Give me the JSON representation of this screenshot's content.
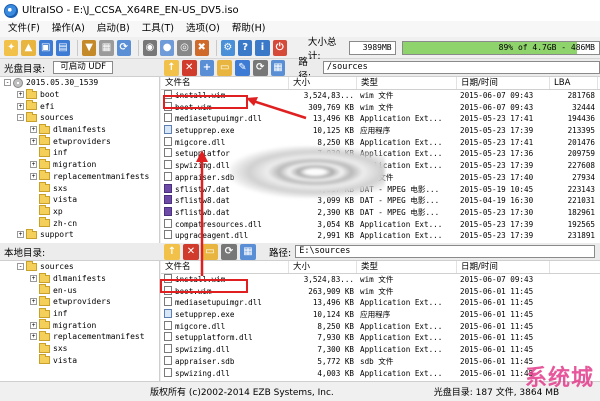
{
  "window": {
    "title": "UltraISO - E:\\J_CCSA_X64RE_EN-US_DV5.iso"
  },
  "menu": [
    "文件(F)",
    "操作(A)",
    "启动(B)",
    "工具(T)",
    "选项(O)",
    "帮助(H)"
  ],
  "toolbar": {
    "size_label": "大小总计:",
    "size_value": "3989MB",
    "capacity_text": "89% of 4.7GB - 486MB",
    "capacity_fraction": 0.89
  },
  "top": {
    "tree_label": "光盘目录:",
    "boot_label": "可启动 UDF",
    "path_label": "路径:",
    "path": "/sources",
    "tree": [
      {
        "label": "2015.05.30_1539",
        "level": 0,
        "exp": "-",
        "icon": "disc"
      },
      {
        "label": "boot",
        "level": 1,
        "exp": "+",
        "icon": "folder"
      },
      {
        "label": "efi",
        "level": 1,
        "exp": "+",
        "icon": "folder"
      },
      {
        "label": "sources",
        "level": 1,
        "exp": "-",
        "icon": "folder"
      },
      {
        "label": "dlmanifests",
        "level": 2,
        "exp": "+",
        "icon": "folder"
      },
      {
        "label": "etwproviders",
        "level": 2,
        "exp": "+",
        "icon": "folder"
      },
      {
        "label": "inf",
        "level": 2,
        "exp": "",
        "icon": "folder"
      },
      {
        "label": "migration",
        "level": 2,
        "exp": "+",
        "icon": "folder"
      },
      {
        "label": "replacementmanifests",
        "level": 2,
        "exp": "+",
        "icon": "folder"
      },
      {
        "label": "sxs",
        "level": 2,
        "exp": "",
        "icon": "folder"
      },
      {
        "label": "vista",
        "level": 2,
        "exp": "",
        "icon": "folder"
      },
      {
        "label": "xp",
        "level": 2,
        "exp": "",
        "icon": "folder"
      },
      {
        "label": "zh-cn",
        "level": 2,
        "exp": "",
        "icon": "folder"
      },
      {
        "label": "support",
        "level": 1,
        "exp": "+",
        "icon": "folder"
      }
    ],
    "columns": [
      "文件名",
      "大小",
      "类型",
      "日期/时间",
      "LBA"
    ],
    "rows": [
      {
        "name": "install.wim",
        "size": "3,524,83...",
        "type": "wim 文件",
        "date": "2015-06-07 09:43",
        "lba": "281768",
        "icon": ""
      },
      {
        "name": "boot.wim",
        "size": "309,769 KB",
        "type": "wim 文件",
        "date": "2015-06-07 09:43",
        "lba": "32444",
        "icon": ""
      },
      {
        "name": "mediasetupuimgr.dll",
        "size": "13,496 KB",
        "type": "Application Ext...",
        "date": "2015-05-23 17:41",
        "lba": "194436",
        "icon": ""
      },
      {
        "name": "setupprep.exe",
        "size": "10,125 KB",
        "type": "应用程序",
        "date": "2015-05-23 17:39",
        "lba": "213395",
        "icon": "exe"
      },
      {
        "name": "migcore.dll",
        "size": "8,250 KB",
        "type": "Application Ext...",
        "date": "2015-05-23 17:41",
        "lba": "201476",
        "icon": ""
      },
      {
        "name": "setupplatfor",
        "size": "7,930 KB",
        "type": "Application Ext...",
        "date": "2015-05-23 17:36",
        "lba": "209759",
        "icon": ""
      },
      {
        "name": "spwizimg.dll",
        "size": "7,300 KB",
        "type": "Application Ext...",
        "date": "2015-05-23 17:39",
        "lba": "227608",
        "icon": ""
      },
      {
        "name": "appraiser.sdb",
        "size": "5,728 KB",
        "type": "sdb 文件",
        "date": "2015-05-23 17:40",
        "lba": "27934",
        "icon": ""
      },
      {
        "name": "sflistw7.dat",
        "size": "4,817 KB",
        "type": "DAT - MPEG 电影...",
        "date": "2015-05-19 10:45",
        "lba": "223143",
        "icon": "dat"
      },
      {
        "name": "sflistw8.dat",
        "size": "3,099 KB",
        "type": "DAT - MPEG 电影...",
        "date": "2015-04-19 16:30",
        "lba": "221031",
        "icon": "dat"
      },
      {
        "name": "sflistwb.dat",
        "size": "2,390 KB",
        "type": "DAT - MPEG 电影...",
        "date": "2015-05-23 17:30",
        "lba": "182961",
        "icon": "dat"
      },
      {
        "name": "compatresources.dll",
        "size": "3,054 KB",
        "type": "Application Ext...",
        "date": "2015-05-23 17:39",
        "lba": "192565",
        "icon": ""
      },
      {
        "name": "upgradeagent.dll",
        "size": "2,991 KB",
        "type": "Application Ext...",
        "date": "2015-05-23 17:39",
        "lba": "231891",
        "icon": ""
      }
    ]
  },
  "bottom": {
    "tree_label": "本地目录:",
    "path_label": "路径:",
    "path": "E:\\sources",
    "tree": [
      {
        "label": "sources",
        "level": 1,
        "exp": "-",
        "icon": "folder"
      },
      {
        "label": "dlmanifests",
        "level": 2,
        "exp": "+",
        "icon": "folder"
      },
      {
        "label": "en-us",
        "level": 2,
        "exp": "",
        "icon": "folder"
      },
      {
        "label": "etwproviders",
        "level": 2,
        "exp": "+",
        "icon": "folder"
      },
      {
        "label": "inf",
        "level": 2,
        "exp": "",
        "icon": "folder"
      },
      {
        "label": "migration",
        "level": 2,
        "exp": "+",
        "icon": "folder"
      },
      {
        "label": "replacementmanifest",
        "level": 2,
        "exp": "+",
        "icon": "folder"
      },
      {
        "label": "sxs",
        "level": 2,
        "exp": "",
        "icon": "folder"
      },
      {
        "label": "vista",
        "level": 2,
        "exp": "",
        "icon": "folder"
      }
    ],
    "columns": [
      "文件名",
      "大小",
      "类型",
      "日期/时间"
    ],
    "rows": [
      {
        "name": "install.wim",
        "size": "3,524,83...",
        "type": "wim 文件",
        "date": "2015-06-07 09:43",
        "icon": ""
      },
      {
        "name": "boot.wim",
        "size": "263,909 KB",
        "type": "wim 文件",
        "date": "2015-06-01 11:45",
        "icon": ""
      },
      {
        "name": "mediasetupuimgr.dll",
        "size": "13,496 KB",
        "type": "Application Ext...",
        "date": "2015-06-01 11:45",
        "icon": ""
      },
      {
        "name": "setupprep.exe",
        "size": "10,124 KB",
        "type": "应用程序",
        "date": "2015-06-01 11:45",
        "icon": "exe"
      },
      {
        "name": "migcore.dll",
        "size": "8,250 KB",
        "type": "Application Ext...",
        "date": "2015-06-01 11:45",
        "icon": ""
      },
      {
        "name": "setupplatform.dll",
        "size": "7,930 KB",
        "type": "Application Ext...",
        "date": "2015-06-01 11:45",
        "icon": ""
      },
      {
        "name": "spwizimg.dll",
        "size": "7,300 KB",
        "type": "Application Ext...",
        "date": "2015-06-01 11:45",
        "icon": ""
      },
      {
        "name": "appraiser.sdb",
        "size": "5,772 KB",
        "type": "sdb 文件",
        "date": "2015-06-01 11:45",
        "icon": ""
      },
      {
        "name": "spwizing.dll",
        "size": "4,003 KB",
        "type": "Application Ext...",
        "date": "2015-06-01 11:45",
        "icon": ""
      }
    ]
  },
  "status": {
    "copyright": "版权所有 (c)2002-2014 EZB Systems, Inc.",
    "disc_info": "光盘目录: 187 文件, 3864 MB",
    "watermark": "系统城"
  }
}
